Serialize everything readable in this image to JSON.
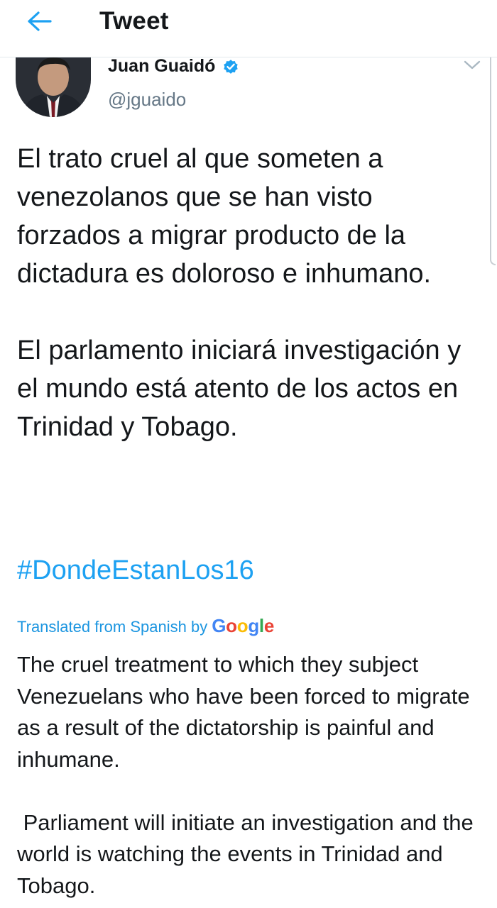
{
  "header": {
    "title": "Tweet",
    "back_icon": "arrow-left-icon",
    "accent": "#1da1f2"
  },
  "tweet": {
    "author_name": "Juan Guaidó",
    "verified_icon": "verified-badge-icon",
    "handle": "@jguaido",
    "text_paragraphs": [
      "El trato cruel al que someten a venezolanos que se han visto forzados a migrar producto de la dictadura es doloroso e inhumano.",
      "El parlamento iniciará investigación y el mundo está atento de los actos en Trinidad y Tobago."
    ],
    "hashtag": "#DondeEstanLos16",
    "translation": {
      "label": "Translated from Spanish by",
      "provider": "Google",
      "paragraphs": [
        "The cruel treatment to which they subject Venezuelans who have been forced to migrate as a result of the dictatorship is painful and inhumane.",
        " Parliament will initiate an investigation and the world is watching the events in Trinidad and Tobago."
      ]
    }
  }
}
